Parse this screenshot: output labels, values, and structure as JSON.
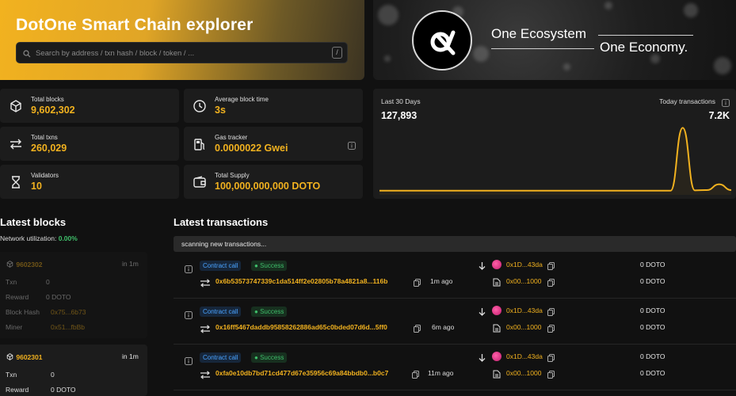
{
  "hero": {
    "title": "DotOne Smart Chain explorer",
    "search_placeholder": "Search by address / txn hash / block / token / ...",
    "shortcut_key": "/"
  },
  "banner": {
    "line1": "One Ecosystem",
    "line2": "One Economy."
  },
  "stats": {
    "total_blocks_label": "Total blocks",
    "total_blocks": "9,602,302",
    "avg_block_time_label": "Average block time",
    "avg_block_time": "3s",
    "total_txns_label": "Total txns",
    "total_txns": "260,029",
    "gas_tracker_label": "Gas tracker",
    "gas_tracker": "0.0000022 Gwei",
    "validators_label": "Validators",
    "validators": "10",
    "total_supply_label": "Total Supply",
    "total_supply": "100,000,000,000 DOTO"
  },
  "chart_panel": {
    "left_label": "Last 30 Days",
    "left_value": "127,893",
    "right_label": "Today transactions",
    "right_value": "7.2K"
  },
  "chart_data": {
    "type": "area",
    "title": "",
    "xlabel": "",
    "ylabel": "",
    "x": [
      1,
      2,
      3,
      4,
      5,
      6,
      7,
      8,
      9,
      10,
      11,
      12,
      13,
      14,
      15,
      16,
      17,
      18,
      19,
      20,
      21,
      22,
      23,
      24,
      25,
      26,
      27,
      28,
      29,
      30
    ],
    "values": [
      180,
      180,
      180,
      180,
      180,
      180,
      180,
      180,
      180,
      180,
      180,
      180,
      180,
      180,
      180,
      180,
      180,
      180,
      180,
      180,
      180,
      180,
      180,
      180,
      180,
      12000,
      250,
      300,
      1400,
      300
    ],
    "ylim": [
      0,
      12500
    ],
    "grid": false,
    "color": "#f2b21f"
  },
  "blocks": {
    "title": "Latest blocks",
    "net_util_label": "Network utilization:",
    "net_util_value": "0.00%",
    "items": [
      {
        "number": "9602302",
        "age": "in 1m",
        "txn_label": "Txn",
        "txn": "0",
        "reward_label": "Reward",
        "reward": "0 DOTO",
        "hash_label": "Block Hash",
        "hash": "0x75...6b73",
        "miner_label": "Miner",
        "miner": "0x51...fbBb"
      },
      {
        "number": "9602301",
        "age": "in 1m",
        "txn_label": "Txn",
        "txn": "0",
        "reward_label": "Reward",
        "reward": "0 DOTO"
      }
    ]
  },
  "transactions": {
    "title": "Latest transactions",
    "scanning": "scanning new transactions...",
    "items": [
      {
        "type": "Contract call",
        "status": "Success",
        "hash": "0x6b53573747339c1da514ff2e02805b78a4821a8...116b",
        "age": "1m ago",
        "from": "0x1D...43da",
        "to": "0x00...1000",
        "value": "0 DOTO",
        "fee": "0 DOTO"
      },
      {
        "type": "Contract call",
        "status": "Success",
        "hash": "0x16ff5467daddb95858262886ad65c0bded07d6d...5ff0",
        "age": "6m ago",
        "from": "0x1D...43da",
        "to": "0x00...1000",
        "value": "0 DOTO",
        "fee": "0 DOTO"
      },
      {
        "type": "Contract call",
        "status": "Success",
        "hash": "0xfa0e10db7bd71cd477d67e35956c69a84bbdb0...b0c7",
        "age": "11m ago",
        "from": "0x1D...43da",
        "to": "0x00...1000",
        "value": "0 DOTO",
        "fee": "0 DOTO"
      }
    ]
  }
}
